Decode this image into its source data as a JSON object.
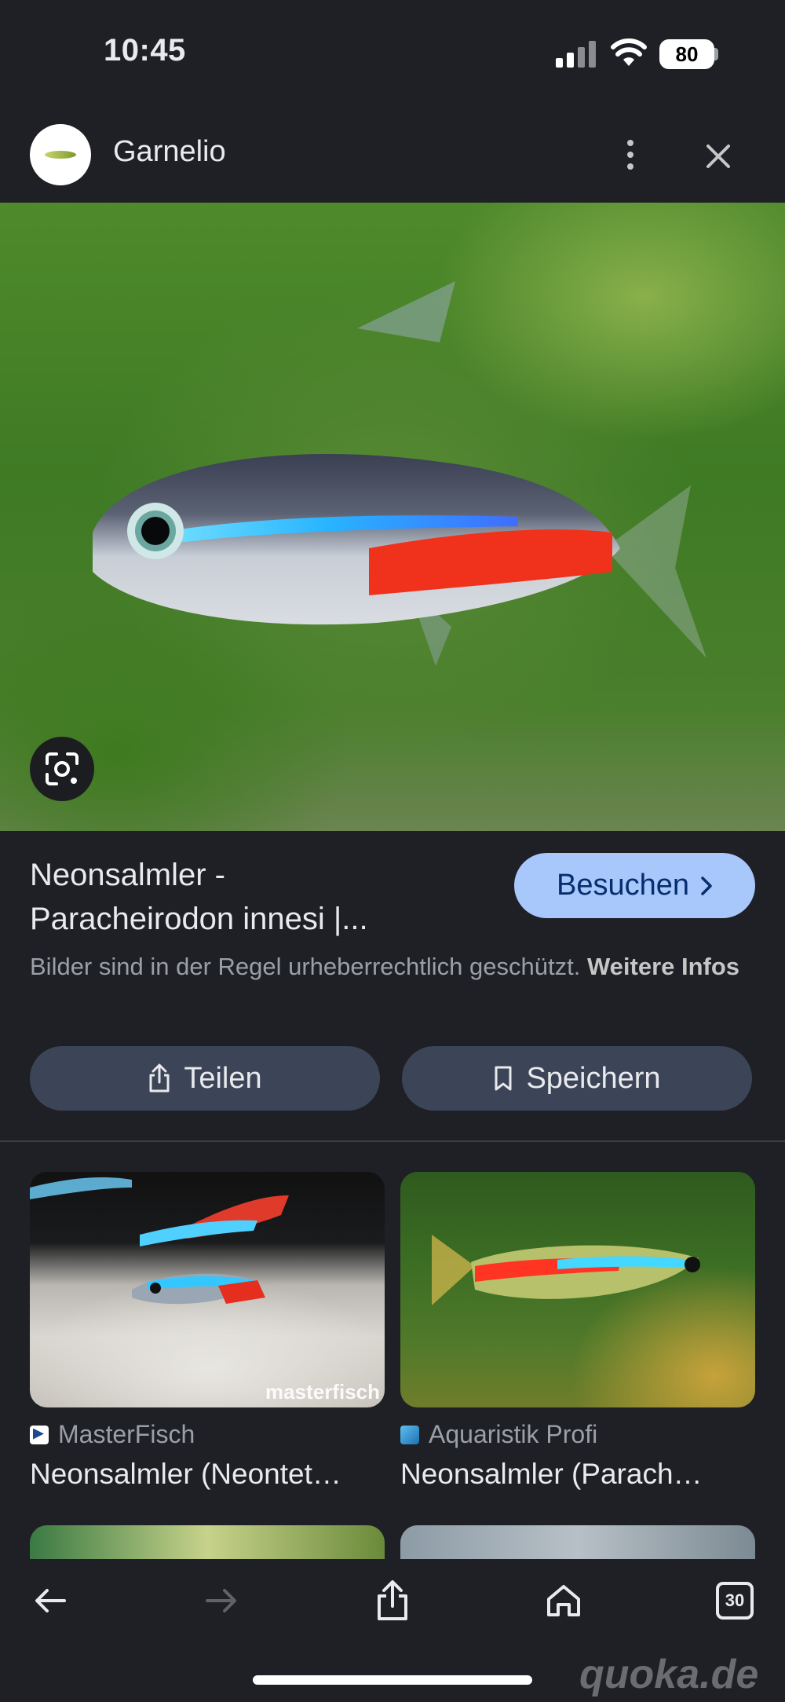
{
  "status_bar": {
    "time": "10:45",
    "battery": "80"
  },
  "header": {
    "site_name": "Garnelio",
    "menu_icon": "more-vert-icon",
    "close_icon": "close-icon"
  },
  "hero": {
    "image_desc_icon": "google-lens-icon"
  },
  "result": {
    "title_line1": "Neonsalmler -",
    "title_line2": "Paracheirodon innesi |...",
    "visit_label": "Besuchen",
    "copyright_text": "Bilder sind in der Regel urheberrechtlich geschützt.",
    "more_info_link": "Weitere Infos",
    "share_label": "Teilen",
    "save_label": "Speichern"
  },
  "related": [
    {
      "source": "MasterFisch",
      "title": "Neonsalmler (Neontet…",
      "thumb_watermark": "masterfisch"
    },
    {
      "source": "Aquaristik Profi",
      "title": "Neonsalmler (Parach…"
    }
  ],
  "toolbar": {
    "tabs_count": "30"
  },
  "watermark": "quoka.de",
  "colors": {
    "background": "#1f2025",
    "visit_button": "#a8c7fa",
    "pill_button": "#3c4557"
  }
}
